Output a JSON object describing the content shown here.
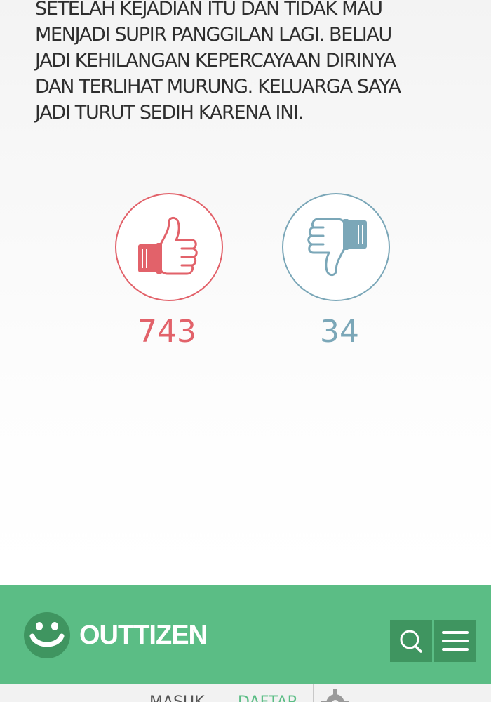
{
  "article": {
    "lines": [
      "SETELAH KEJADIAN ITU DAN TIDAK MAU",
      "MENJADI SUPIR PANGGILAN LAGI. BELIAU",
      "JADI KEHILANGAN KEPERCAYAAN DIRINYA",
      "DAN TERLIHAT MURUNG. KELUARGA SAYA",
      "JADI TURUT SEDIH KARENA INI."
    ]
  },
  "votes": {
    "like": {
      "count": "743",
      "icon": "thumbs-up-icon",
      "color": "#e2626a"
    },
    "dislike": {
      "count": "34",
      "icon": "thumbs-down-icon",
      "color": "#7ba7b8"
    }
  },
  "footer": {
    "brand": "OUTTIZEN",
    "logo_icon": "smiley-logo-icon",
    "bar_color": "#5bbd85",
    "button_color": "#3f9560",
    "search_icon": "search-icon",
    "menu_icon": "hamburger-menu-icon"
  },
  "bottom_nav": {
    "login": "MASUK",
    "register": "DAFTAR",
    "settings_icon": "gear-icon"
  }
}
